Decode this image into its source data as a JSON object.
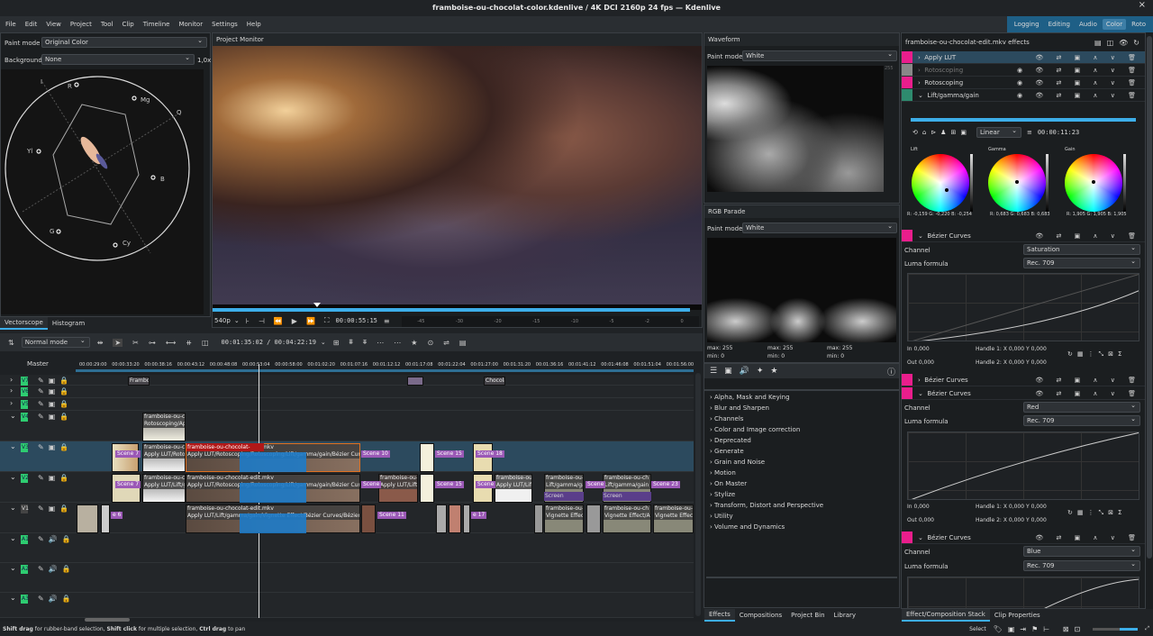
{
  "window": {
    "title": "framboise-ou-chocolat-color.kdenlive / 4K DCI 2160p 24 fps — Kdenlive",
    "close": "×"
  },
  "menu": [
    "File",
    "Edit",
    "View",
    "Project",
    "Tool",
    "Clip",
    "Timeline",
    "Monitor",
    "Settings",
    "Help"
  ],
  "workspaces": [
    "Logging",
    "Editing",
    "Audio",
    "Color",
    "Roto"
  ],
  "vectorscope": {
    "paint_mode_label": "Paint mode",
    "paint_mode": "Original Color",
    "background_label": "Background",
    "background": "None",
    "zoom": "1,0x",
    "labels": {
      "i": "I",
      "r": "R",
      "mg": "Mg",
      "q": "Q",
      "yl": "Yl",
      "b": "B",
      "g": "G",
      "cy": "Cy"
    },
    "tabs": [
      "Vectorscope",
      "Histogram"
    ]
  },
  "monitor": {
    "title": "Project Monitor",
    "resolution": "540p",
    "timecode": "00:00:55:15",
    "meter_ticks": [
      "-45",
      "-30",
      "-20",
      "-15",
      "-10",
      "-5",
      "-2",
      "0"
    ]
  },
  "waveform": {
    "title": "Waveform",
    "paint_mode_label": "Paint mode",
    "paint_mode": "White",
    "max_tick": "255"
  },
  "rgb_parade": {
    "title": "RGB Parade",
    "paint_mode_label": "Paint mode",
    "paint_mode": "White",
    "stats": [
      {
        "max_label": "max:",
        "max": "255",
        "min_label": "min:",
        "min": "0"
      },
      {
        "max_label": "max:",
        "max": "255",
        "min_label": "min:",
        "min": "0"
      },
      {
        "max_label": "max:",
        "max": "255",
        "min_label": "min:",
        "min": "0"
      }
    ]
  },
  "effects_list": {
    "categories": [
      "Alpha, Mask and Keying",
      "Blur and Sharpen",
      "Channels",
      "Color and Image correction",
      "Deprecated",
      "Generate",
      "Grain and Noise",
      "Motion",
      "On Master",
      "Stylize",
      "Transform, Distort and Perspective",
      "Utility",
      "Volume and Dynamics"
    ],
    "tabs": [
      "Effects",
      "Compositions",
      "Project Bin",
      "Library"
    ]
  },
  "timeline": {
    "mode": "Normal mode",
    "timecode": "00:01:35:02 / 00:04:22:19",
    "master": "Master",
    "ruler": [
      "00:00:29:00",
      "00:00:33:20",
      "00:00:38:16",
      "00:00:43:12",
      "00:00:48:08",
      "00:00:53:04",
      "00:00:58:00",
      "00:01:02:20",
      "00:01:07:16",
      "00:01:12:12",
      "00:01:17:08",
      "00:01:22:04",
      "00:01:27:00",
      "00:01:31:20",
      "00:01:36:16",
      "00:01:41:12",
      "00:01:46:08",
      "00:01:51:04",
      "00:01:56:00"
    ],
    "tracks": [
      "V7",
      "V6",
      "V5",
      "V4",
      "V3",
      "V2",
      "V1",
      "A1",
      "A2",
      "A3"
    ],
    "clips": {
      "framb": "framboise-ou-cho",
      "edit": "framboise-ou-chocolat-edit.mkv",
      "roto_appl": "Rotoscoping/Appl",
      "apply_roto": "Apply LUT/Rotoscc",
      "v3_fx": "Apply LUT/Rotoscoping/Rotoscoping/Lift/gamma/gain/Bézier Curves/Bézie",
      "apply_lift": "Apply LUT/Lift/gar",
      "v2_fx": "Apply LUT/Rotoscoping/Rotoscoping/Lift/gamma/gain/Bézier Curves/Bézie",
      "v1_fx": "Apply LUT/Lift/gamma/gain/Vignette Effect/Bézier Curves/Bézier Curves/Bé",
      "framboise": "Framboise",
      "chocolat": "Chocolat",
      "lift_gl": "Lift/gamma/gain",
      "vignette": "Vignette Effect/A",
      "screen": "Screen",
      "framb2": "framboise-ou-ch",
      "apply_lift2": "Apply LUT/Lift/g"
    },
    "scenes": {
      "s7": "Scene 7",
      "s10": "Scene 10",
      "s15": "Scene 15",
      "s18": "Scene 18",
      "s23": "Scene 23",
      "s11": "Scene 11",
      "s6": "e 6",
      "s17": "e 17",
      "scene": "Scene"
    }
  },
  "effect_stack": {
    "title": "framboise-ou-chocolat-edit.mkv effects",
    "effects": [
      "Apply LUT",
      "Rotoscoping",
      "Rotoscoping",
      "Lift/gamma/gain"
    ],
    "lgg": {
      "interp": "Linear",
      "timecode": "00:00:11:23",
      "lift_label": "Lift",
      "gamma_label": "Gamma",
      "gain_label": "Gain",
      "lift_vals": "R: -0,159  G: -0,220  B: -0,254",
      "gamma_vals": "R: 0,683  G: 0,683  B: 0,683",
      "gain_vals": "R: 1,905  G: 1,905  B: 1,905"
    },
    "bezier": [
      {
        "name": "Bézier Curves",
        "channel": "Saturation",
        "luma": "Rec. 709"
      },
      {
        "name": "Bézier Curves"
      },
      {
        "name": "Bézier Curves",
        "channel": "Red",
        "luma": "Rec. 709"
      },
      {
        "name": "Bézier Curves",
        "channel": "Blue",
        "luma": "Rec. 709"
      }
    ],
    "channel_label": "Channel",
    "luma_label": "Luma formula",
    "in_label": "In",
    "in_val": "0,000",
    "out_label": "Out",
    "out_val": "0,000",
    "h1": "Handle 1:",
    "h2": "Handle 2:",
    "x": "X",
    "y": "Y",
    "zero": "0,000",
    "tabs": [
      "Effect/Composition Stack",
      "Clip Properties"
    ]
  },
  "status": {
    "hint_b1": "Shift drag",
    "hint_t1": " for rubber-band selection, ",
    "hint_b2": "Shift click",
    "hint_t2": " for multiple selection, ",
    "hint_b3": "Ctrl drag",
    "hint_t3": " to pan",
    "select": "Select"
  },
  "colors": {
    "accent": "#3daee9",
    "effect_tag": "#e91e8c",
    "track_tag": "#2ecc71",
    "scene": "#9b59b6",
    "workspace_bar": "#1e5f86"
  }
}
